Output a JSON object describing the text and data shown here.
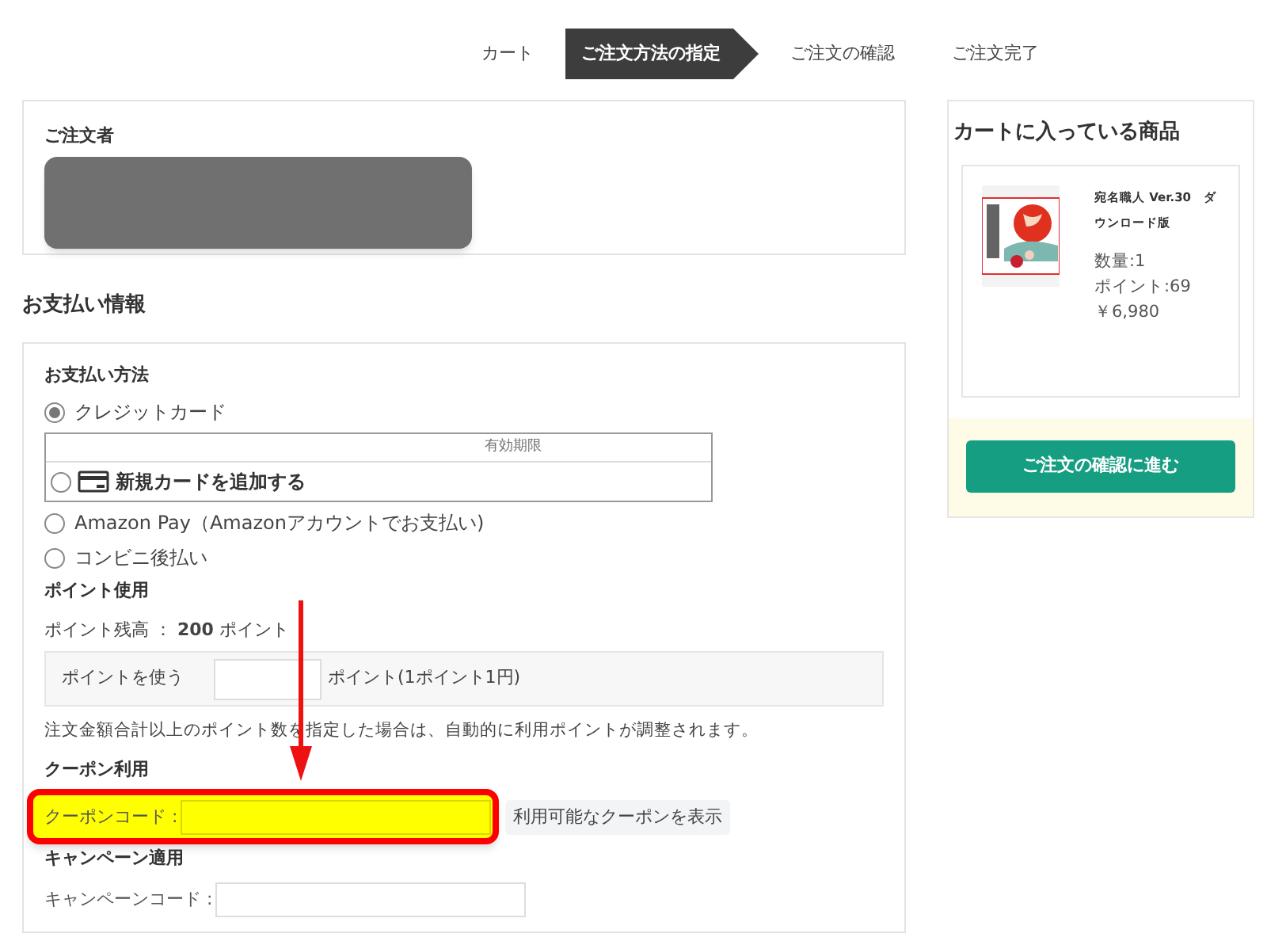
{
  "steps": [
    {
      "label": "カート",
      "selected": false
    },
    {
      "label": "ご注文方法の指定",
      "selected": true
    },
    {
      "label": "ご注文の確認",
      "selected": false
    },
    {
      "label": "ご注文完了",
      "selected": false
    }
  ],
  "orderer": {
    "title": "ご注文者",
    "redacted": true
  },
  "payment": {
    "title": "お支払い情報",
    "method_title": "お支払い方法",
    "methods": [
      {
        "kind": "radio",
        "label": "クレジットカード",
        "selected": true
      },
      {
        "kind": "card",
        "header": "有効期限",
        "label": "新規カードを追加する",
        "selected": false
      },
      {
        "kind": "radio",
        "label": "Amazon Pay（Amazonアカウントでお支払い)",
        "selected": false
      },
      {
        "kind": "radio",
        "label": "コンビニ後払い",
        "selected": false
      }
    ]
  },
  "points": {
    "title": "ポイント使用",
    "balance": "ポイント残高 ： **200** ポイント",
    "use_label": "ポイントを使う",
    "unit": "ポイント(1ポイント1円)",
    "note": "注文金額合計以上のポイント数を指定した場合は、自動的に利用ポイントが調整されます。"
  },
  "coupon": {
    "title": "クーポン利用",
    "label": "クーポンコード :",
    "highlighted": true,
    "button": "利用可能なクーポンを表示"
  },
  "campaign": {
    "title": "キャンペーン適用",
    "label": "キャンペーンコード :"
  },
  "cart": {
    "title": "カートに入っている商品",
    "item": {
      "name": "宛名職人 Ver.30　ダウンロード版",
      "quantity": "数量:1",
      "points": "ポイント:69",
      "price": "￥6,980"
    },
    "button": "ご注文の確認に進む"
  }
}
